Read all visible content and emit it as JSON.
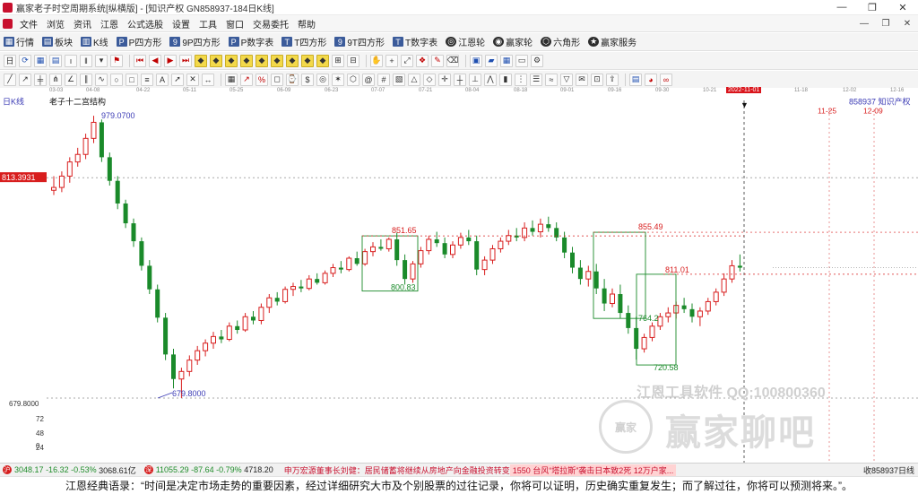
{
  "window": {
    "title": "赢家老子时空周期系统[纵横版] - [知识产权   GN858937-184日K线]",
    "minimize": "—",
    "maximize": "❐",
    "close": "✕",
    "sub_minimize": "—",
    "sub_restore": "❐",
    "sub_close": "✕"
  },
  "menu": {
    "items": [
      "文件",
      "浏览",
      "资讯",
      "江恩",
      "公式选股",
      "设置",
      "工具",
      "窗口",
      "交易委托",
      "帮助"
    ]
  },
  "toolbar1": {
    "items": [
      {
        "label": "行情",
        "icon": "grid-icon"
      },
      {
        "label": "板块",
        "icon": "blocks-icon"
      },
      {
        "label": "K线",
        "icon": "candle-icon"
      },
      {
        "label": "P四方形",
        "icon": "p-square-icon"
      },
      {
        "label": "9P四方形",
        "icon": "9p-square-icon"
      },
      {
        "label": "P数字表",
        "icon": "p-table-icon"
      },
      {
        "label": "T四方形",
        "icon": "t-square-icon"
      },
      {
        "label": "9T四方形",
        "icon": "9t-square-icon"
      },
      {
        "label": "T数字表",
        "icon": "t-table-icon"
      },
      {
        "label": "江恩轮",
        "icon": "gann-wheel-icon"
      },
      {
        "label": "赢家轮",
        "icon": "winner-wheel-icon"
      },
      {
        "label": "六角形",
        "icon": "hexagon-icon"
      },
      {
        "label": "赢家服务",
        "icon": "service-icon"
      }
    ]
  },
  "chart": {
    "timeframe_label": "日K线",
    "study_title": "老子十二宫结构",
    "symbol_tag": "858937 知识产权",
    "current_price_tag": "813.3931",
    "bottom_price_label": "679.8000",
    "axis_labels": [
      "679.8000",
      "72",
      "48",
      "24",
      "0"
    ],
    "annotations": {
      "high": "979.0700",
      "low": "679.8000",
      "box1_top": "851.65",
      "box1_bottom": "800.83",
      "box2_top": "855.49",
      "box2_mid": "811.01",
      "box2_low1": "764.2",
      "box2_low2": "720.58"
    },
    "future_dates": [
      "11-25",
      "12-09"
    ],
    "date_ticks": [
      "03-03",
      "04-08",
      "04-22",
      "05-11",
      "05-25",
      "06-09",
      "06-23",
      "07-07",
      "07-21",
      "08-04",
      "08-18",
      "09-01",
      "09-16",
      "09-30",
      "10-21",
      "2022-11-01",
      "11-18",
      "12-02",
      "12-16"
    ],
    "colors": {
      "up": "#d81e1e",
      "down": "#1a8a2a",
      "box": "#1a8a2a",
      "dashed_red": "#d81e1e",
      "label_blue": "#3b3bb5"
    }
  },
  "status": {
    "sh_index": "3048.17",
    "sh_change": "-16.32",
    "sh_pct": "-0.53%",
    "sh_amount": "3068.61亿",
    "sz_index": "11055.29",
    "sz_change": "-87.64",
    "sz_pct": "-0.79%",
    "sz_amount": "4718.20",
    "news1": "申万宏源董事长刘健：居民储蓄将继续从房地产向金融投资转变",
    "news2": "1550 台风“塔拉斯”袭击日本致2死 12万户家...",
    "right_info": "收858937日线"
  },
  "quote": {
    "text": "江恩经典语录：“时间是决定市场走势的重要因素，经过详细研究大市及个别股票的过往记录，你将可以证明，历史确实重复发生；而了解过往，你将可以预测将来。”。"
  },
  "watermark": {
    "tool_text": "江恩工具软件  QQ:100800360",
    "logo_text": "赢家",
    "big_text": "赢家聊吧"
  }
}
